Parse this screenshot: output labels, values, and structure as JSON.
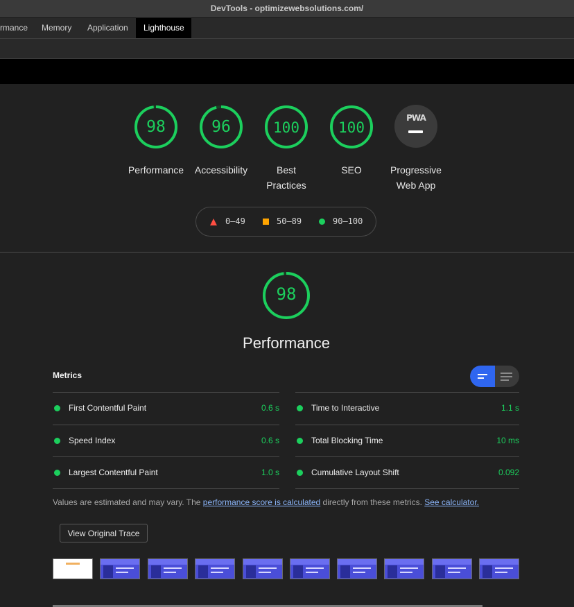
{
  "window": {
    "title": "DevTools - optimizewebsolutions.com/"
  },
  "tabs": [
    {
      "label": "rmance"
    },
    {
      "label": "Memory"
    },
    {
      "label": "Application"
    },
    {
      "label": "Lighthouse",
      "active": true
    }
  ],
  "categories": [
    {
      "score": "98",
      "score_value": 98,
      "label": "Performance"
    },
    {
      "score": "96",
      "score_value": 96,
      "label": "Accessibility"
    },
    {
      "score": "100",
      "score_value": 100,
      "label_line1": "Best",
      "label_line2": "Practices"
    },
    {
      "score": "100",
      "score_value": 100,
      "label": "SEO"
    },
    {
      "badge": "PWA",
      "label_line1": "Progressive",
      "label_line2": "Web App"
    }
  ],
  "legend": [
    {
      "shape": "triangle",
      "range": "0–49",
      "color": "#ff4e42"
    },
    {
      "shape": "square",
      "range": "50–89",
      "color": "#ffa400"
    },
    {
      "shape": "circle",
      "range": "90–100",
      "color": "#1ccf5d"
    }
  ],
  "performance": {
    "score": "98",
    "score_value": 98,
    "title": "Performance"
  },
  "metrics": {
    "title": "Metrics",
    "items": [
      {
        "label": "First Contentful Paint",
        "value": "0.6 s"
      },
      {
        "label": "Time to Interactive",
        "value": "1.1 s"
      },
      {
        "label": "Speed Index",
        "value": "0.6 s"
      },
      {
        "label": "Total Blocking Time",
        "value": "10 ms"
      },
      {
        "label": "Largest Contentful Paint",
        "value": "1.0 s"
      },
      {
        "label": "Cumulative Layout Shift",
        "value": "0.092"
      }
    ],
    "status_color": "#1ccf5d"
  },
  "note": {
    "prefix": "Values are estimated and may vary. The ",
    "link1": "performance score is calculated",
    "middle": " directly from these metrics. ",
    "link2": "See calculator."
  },
  "trace_button": "View Original Trace",
  "colors": {
    "pass": "#1ccf5d",
    "average": "#ffa400",
    "fail": "#ff4e42",
    "toggle_active": "#2f66f0",
    "link": "#8ab4f8"
  }
}
